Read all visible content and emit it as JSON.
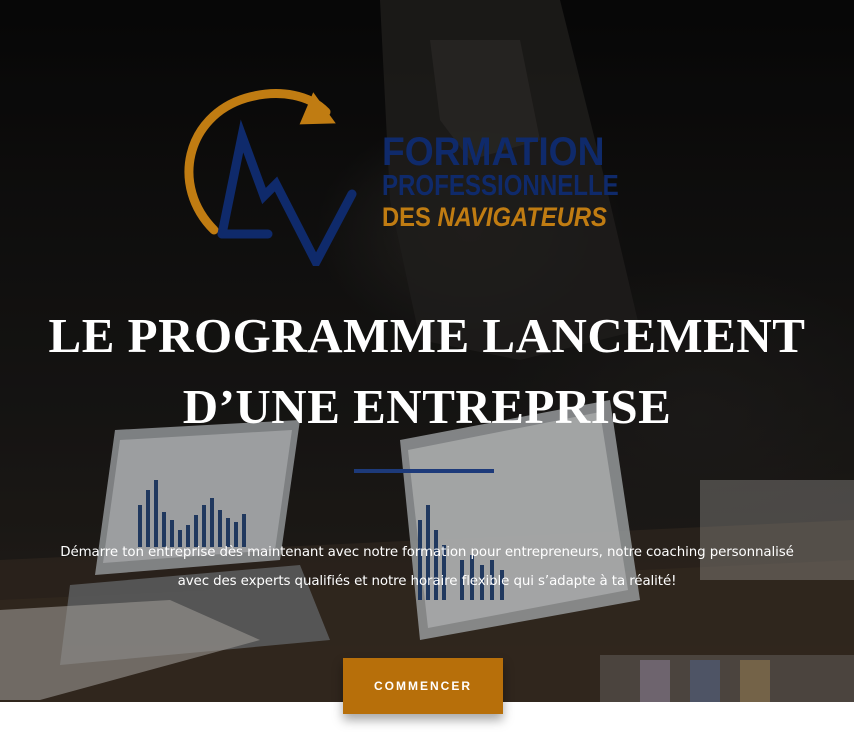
{
  "logo": {
    "line1": "FORMATION",
    "line2": "PROFESSIONNELLE",
    "line3_prefix": "DES",
    "line3_main": "NAVIGATEURS",
    "colors": {
      "navy": "#0f2a6b",
      "gold": "#c07c12"
    }
  },
  "hero": {
    "title_line1": "LE PROGRAMME LANCEMENT",
    "title_line2": "D’UNE ENTREPRISE",
    "description_line1": "Démarre ton entreprise dès maintenant avec notre formation pour entrepreneurs, notre coaching personnalisé",
    "description_line2": "avec des experts qualifiés et notre horaire flexible qui s’adapte à ta réalité!",
    "divider_color": "#1d3a7a"
  },
  "cta": {
    "label": "COMMENCER",
    "color": "#b76f0a"
  }
}
